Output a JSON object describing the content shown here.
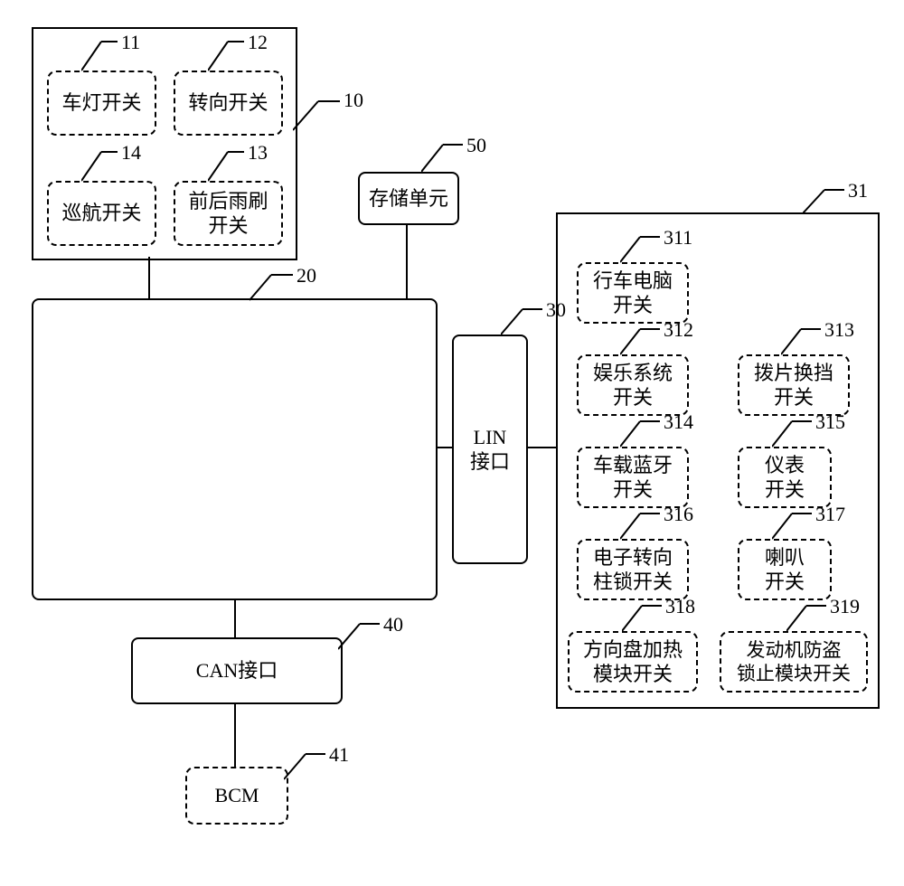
{
  "group_10": {
    "ref": "10",
    "items": {
      "11": {
        "ref": "11",
        "label": "车灯开关"
      },
      "12": {
        "ref": "12",
        "label": "转向开关"
      },
      "13": {
        "ref": "13",
        "label": "前后雨刷\n开关"
      },
      "14": {
        "ref": "14",
        "label": "巡航开关"
      }
    }
  },
  "block_20": {
    "ref": "20"
  },
  "block_30": {
    "ref": "30",
    "label": "LIN\n接口"
  },
  "group_31": {
    "ref": "31",
    "items": {
      "311": {
        "ref": "311",
        "label": "行车电脑\n开关"
      },
      "312": {
        "ref": "312",
        "label": "娱乐系统\n开关"
      },
      "313": {
        "ref": "313",
        "label": "拨片换挡\n开关"
      },
      "314": {
        "ref": "314",
        "label": "车载蓝牙\n开关"
      },
      "315": {
        "ref": "315",
        "label": "仪表\n开关"
      },
      "316": {
        "ref": "316",
        "label": "电子转向\n柱锁开关"
      },
      "317": {
        "ref": "317",
        "label": "喇叭\n开关"
      },
      "318": {
        "ref": "318",
        "label": "方向盘加热\n模块开关"
      },
      "319": {
        "ref": "319",
        "label": "发动机防盗\n锁止模块开关"
      }
    }
  },
  "block_40": {
    "ref": "40",
    "label": "CAN接口"
  },
  "block_41": {
    "ref": "41",
    "label": "BCM"
  },
  "block_50": {
    "ref": "50",
    "label": "存储单元"
  }
}
